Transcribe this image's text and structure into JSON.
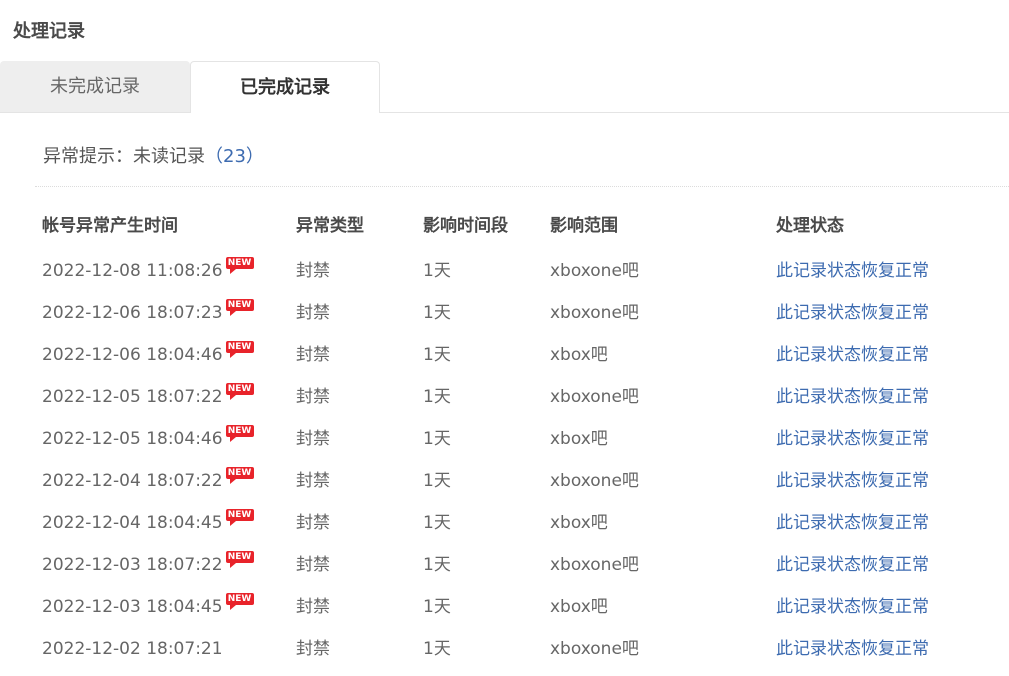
{
  "section": {
    "title": "处理记录"
  },
  "tabs": [
    {
      "label": "未完成记录",
      "active": false
    },
    {
      "label": "已完成记录",
      "active": true
    }
  ],
  "hint": {
    "label": "异常提示：未读记录",
    "count": "（23）"
  },
  "table": {
    "headers": [
      "帐号异常产生时间",
      "异常类型",
      "影响时间段",
      "影响范围",
      "处理状态"
    ],
    "badge_label": "NEW",
    "rows": [
      {
        "time": "2022-12-08 11:08:26",
        "new": true,
        "type": "封禁",
        "duration": "1天",
        "scope": "xboxone吧",
        "status": "此记录状态恢复正常"
      },
      {
        "time": "2022-12-06 18:07:23",
        "new": true,
        "type": "封禁",
        "duration": "1天",
        "scope": "xboxone吧",
        "status": "此记录状态恢复正常"
      },
      {
        "time": "2022-12-06 18:04:46",
        "new": true,
        "type": "封禁",
        "duration": "1天",
        "scope": "xbox吧",
        "status": "此记录状态恢复正常"
      },
      {
        "time": "2022-12-05 18:07:22",
        "new": true,
        "type": "封禁",
        "duration": "1天",
        "scope": "xboxone吧",
        "status": "此记录状态恢复正常"
      },
      {
        "time": "2022-12-05 18:04:46",
        "new": true,
        "type": "封禁",
        "duration": "1天",
        "scope": "xbox吧",
        "status": "此记录状态恢复正常"
      },
      {
        "time": "2022-12-04 18:07:22",
        "new": true,
        "type": "封禁",
        "duration": "1天",
        "scope": "xboxone吧",
        "status": "此记录状态恢复正常"
      },
      {
        "time": "2022-12-04 18:04:45",
        "new": true,
        "type": "封禁",
        "duration": "1天",
        "scope": "xbox吧",
        "status": "此记录状态恢复正常"
      },
      {
        "time": "2022-12-03 18:07:22",
        "new": true,
        "type": "封禁",
        "duration": "1天",
        "scope": "xboxone吧",
        "status": "此记录状态恢复正常"
      },
      {
        "time": "2022-12-03 18:04:45",
        "new": true,
        "type": "封禁",
        "duration": "1天",
        "scope": "xbox吧",
        "status": "此记录状态恢复正常"
      },
      {
        "time": "2022-12-02 18:07:21",
        "new": false,
        "type": "封禁",
        "duration": "1天",
        "scope": "xboxone吧",
        "status": "此记录状态恢复正常"
      }
    ]
  },
  "colors": {
    "link": "#3d6bb0",
    "badge": "#e8232a",
    "tab_inactive_bg": "#eeeeee"
  }
}
